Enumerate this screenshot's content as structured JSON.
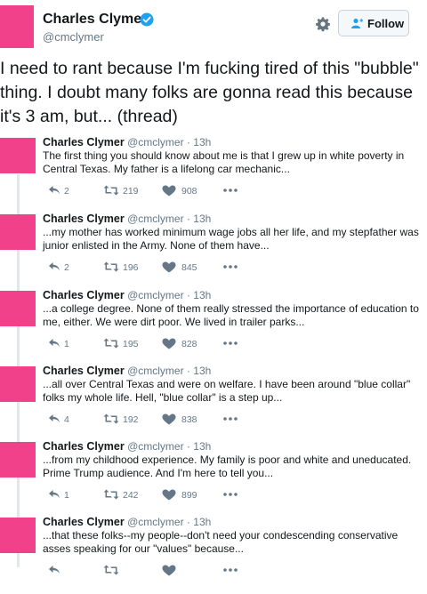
{
  "profile": {
    "name": "Charles Clymer",
    "handle": "@cmclymer",
    "follow_label": "Follow",
    "avatar_color": "#f0418a",
    "verified_icon": "verified-badge-icon"
  },
  "main_tweet": {
    "text": "I need to rant because I'm fucking tired of this \"bubble\" thing. I doubt many folks are gonna read this because it's 3 am, but... (thread)"
  },
  "thread": [
    {
      "name": "Charles Clymer",
      "handle": "@cmclymer",
      "time": "13h",
      "text": "The first thing you should know about me is that I grew up in white poverty in Central Texas. My father is a lifelong car mechanic...",
      "replies": "2",
      "retweets": "219",
      "likes": "908"
    },
    {
      "name": "Charles Clymer",
      "handle": "@cmclymer",
      "time": "13h",
      "text": "...my mother has worked minimum wage jobs all her life, and my stepfather was junior enlisted in the Army. None of them have...",
      "replies": "2",
      "retweets": "196",
      "likes": "845"
    },
    {
      "name": "Charles Clymer",
      "handle": "@cmclymer",
      "time": "13h",
      "text": "...a college degree. None of them really stressed the importance of education to me, either. We were dirt poor. We lived in trailer parks...",
      "replies": "1",
      "retweets": "195",
      "likes": "828"
    },
    {
      "name": "Charles Clymer",
      "handle": "@cmclymer",
      "time": "13h",
      "text": "...all over Central Texas and were on welfare. I have been around \"blue collar\" folks my whole life. Hell, \"blue collar\" is a step up...",
      "replies": "4",
      "retweets": "192",
      "likes": "838"
    },
    {
      "name": "Charles Clymer",
      "handle": "@cmclymer",
      "time": "13h",
      "text": "...from my childhood experience. My family is poor and white and uneducated. Prime Trump audience. And I'm here to tell you...",
      "replies": "1",
      "retweets": "242",
      "likes": "899"
    },
    {
      "name": "Charles Clymer",
      "handle": "@cmclymer",
      "time": "13h",
      "text": "...that these folks--my people--don't need your condescending conservative asses speaking for our \"values\" because...",
      "replies": "",
      "retweets": "",
      "likes": ""
    }
  ],
  "colors": {
    "avatar": "#f0418a",
    "accent": "#1da1f2",
    "muted": "#657786",
    "thread_line": "#e1e8ed"
  }
}
